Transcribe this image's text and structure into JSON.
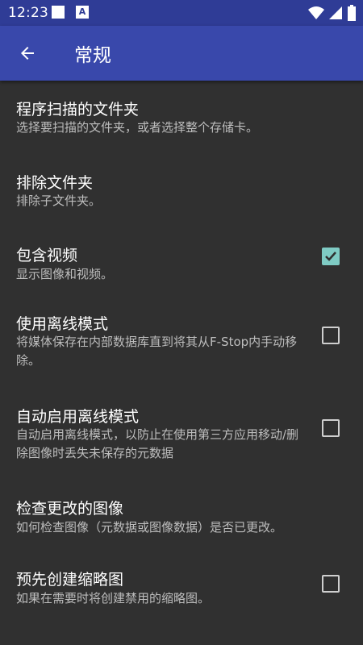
{
  "status_bar": {
    "time": "12:23",
    "a_icon_text": "A",
    "icons": [
      "wifi-icon",
      "cell-signal-icon",
      "battery-icon"
    ]
  },
  "app_bar": {
    "back_icon": "arrow-back-icon",
    "title": "常规"
  },
  "settings": [
    {
      "title": "程序扫描的文件夹",
      "summary": "选择要扫描的文件夹，或者选择整个存储卡。",
      "has_checkbox": false
    },
    {
      "title": "排除文件夹",
      "summary": "排除子文件夹。",
      "has_checkbox": false
    },
    {
      "title": "包含视频",
      "summary": "显示图像和视频。",
      "has_checkbox": true,
      "checked": true
    },
    {
      "title": "使用离线模式",
      "summary": "将媒体保存在内部数据库直到将其从F-Stop内手动移除。",
      "has_checkbox": true,
      "checked": false
    },
    {
      "title": "自动启用离线模式",
      "summary": "自动启用离线模式，以防止在使用第三方应用移动/删除图像时丢失未保存的元数据",
      "has_checkbox": true,
      "checked": false
    },
    {
      "title": "检查更改的图像",
      "summary": "如何检查图像（元数据或图像数据）是否已更改。",
      "has_checkbox": false
    },
    {
      "title": "预先创建缩略图",
      "summary": "如果在需要时将创建禁用的缩略图。",
      "has_checkbox": true,
      "checked": false
    }
  ],
  "colors": {
    "status_bar": "#2f3c96",
    "app_bar": "#3948ab",
    "background": "#303030",
    "accent": "#7fcbc4"
  }
}
